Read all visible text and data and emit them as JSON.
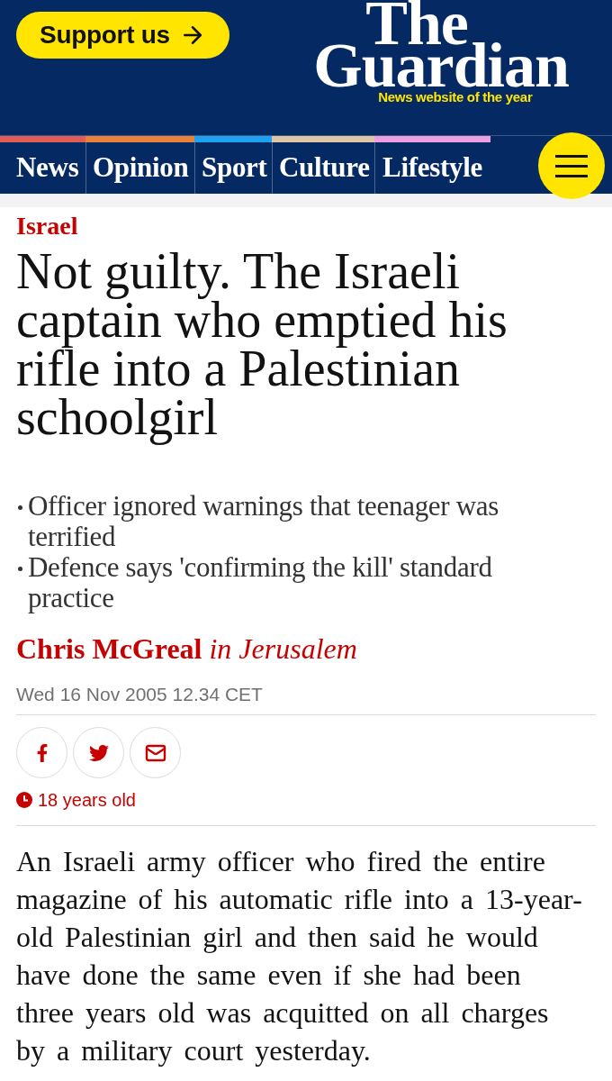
{
  "header": {
    "support_button": "Support us",
    "logo": {
      "line_1": "The",
      "line_2": "Guardian"
    },
    "tagline": "News website of the year"
  },
  "nav": {
    "items": [
      {
        "label": "News",
        "color": "#e05c57"
      },
      {
        "label": "Opinion",
        "color": "#e8823a"
      },
      {
        "label": "Sport",
        "color": "#1ea1ee"
      },
      {
        "label": "Culture",
        "color": "#dcc6a6"
      },
      {
        "label": "Lifestyle",
        "color": "#eca0e0"
      }
    ]
  },
  "article": {
    "section": "Israel",
    "headline": "Not guilty. The Israeli captain who emptied his rifle into a Palestinian schoolgirl",
    "standfirst": [
      "Officer ignored warnings that teenager was terrified",
      "Defence says 'confirming the kill' standard practice"
    ],
    "byline": "**Chris McGreal** *in Jerusalem*",
    "dateline": "Wed 16 Nov 2005 12.34 CET",
    "share_buttons": [
      {
        "kind": "facebook"
      },
      {
        "kind": "twitter"
      },
      {
        "kind": "email"
      }
    ],
    "age_notice": "18 years old",
    "body": "An Israeli army officer who fired the entire magazine of his automatic rifle into a 13-year-old Palestinian girl and then said he would have done the same even if she had been three years old was acquitted on all charges by a military court yesterday."
  }
}
